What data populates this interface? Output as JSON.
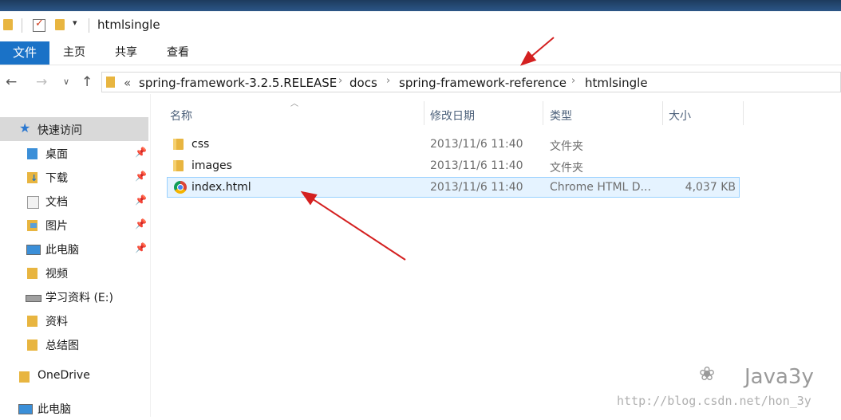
{
  "window": {
    "title": "htmlsingle"
  },
  "ribbon": {
    "tabs": [
      "文件",
      "主页",
      "共享",
      "查看"
    ]
  },
  "address": {
    "overflow": "«",
    "crumbs": [
      "spring-framework-3.2.5.RELEASE",
      "docs",
      "spring-framework-reference",
      "htmlsingle"
    ],
    "separator": "›"
  },
  "sidebar": {
    "quick_access": "快速访问",
    "items": [
      {
        "label": "桌面",
        "pinned": true,
        "icon": "desktop-folder-icon"
      },
      {
        "label": "下载",
        "pinned": true,
        "icon": "download-folder-icon"
      },
      {
        "label": "文档",
        "pinned": true,
        "icon": "documents-folder-icon"
      },
      {
        "label": "图片",
        "pinned": true,
        "icon": "pictures-folder-icon"
      },
      {
        "label": "此电脑",
        "pinned": true,
        "icon": "computer-icon"
      },
      {
        "label": "视频",
        "pinned": false,
        "icon": "folder-icon"
      },
      {
        "label": "学习资料 (E:)",
        "pinned": false,
        "icon": "drive-icon"
      },
      {
        "label": "资料",
        "pinned": false,
        "icon": "folder-icon"
      },
      {
        "label": "总结图",
        "pinned": false,
        "icon": "folder-icon"
      }
    ],
    "onedrive": "OneDrive",
    "this_pc": "此电脑"
  },
  "columns": {
    "name": "名称",
    "modified": "修改日期",
    "type": "类型",
    "size": "大小"
  },
  "files": [
    {
      "name": "css",
      "modified": "2013/11/6 11:40",
      "type": "文件夹",
      "size": "",
      "icon": "folder-icon"
    },
    {
      "name": "images",
      "modified": "2013/11/6 11:40",
      "type": "文件夹",
      "size": "",
      "icon": "folder-icon"
    },
    {
      "name": "index.html",
      "modified": "2013/11/6 11:40",
      "type": "Chrome HTML D...",
      "size": "4,037 KB",
      "icon": "chrome-icon"
    }
  ],
  "watermark": {
    "brand": "Java3y",
    "url": "http://blog.csdn.net/hon_3y"
  },
  "colors": {
    "accent": "#1a72c7",
    "arrow": "#d42020",
    "selection": "#e5f3ff",
    "folder": "#e8b540"
  }
}
